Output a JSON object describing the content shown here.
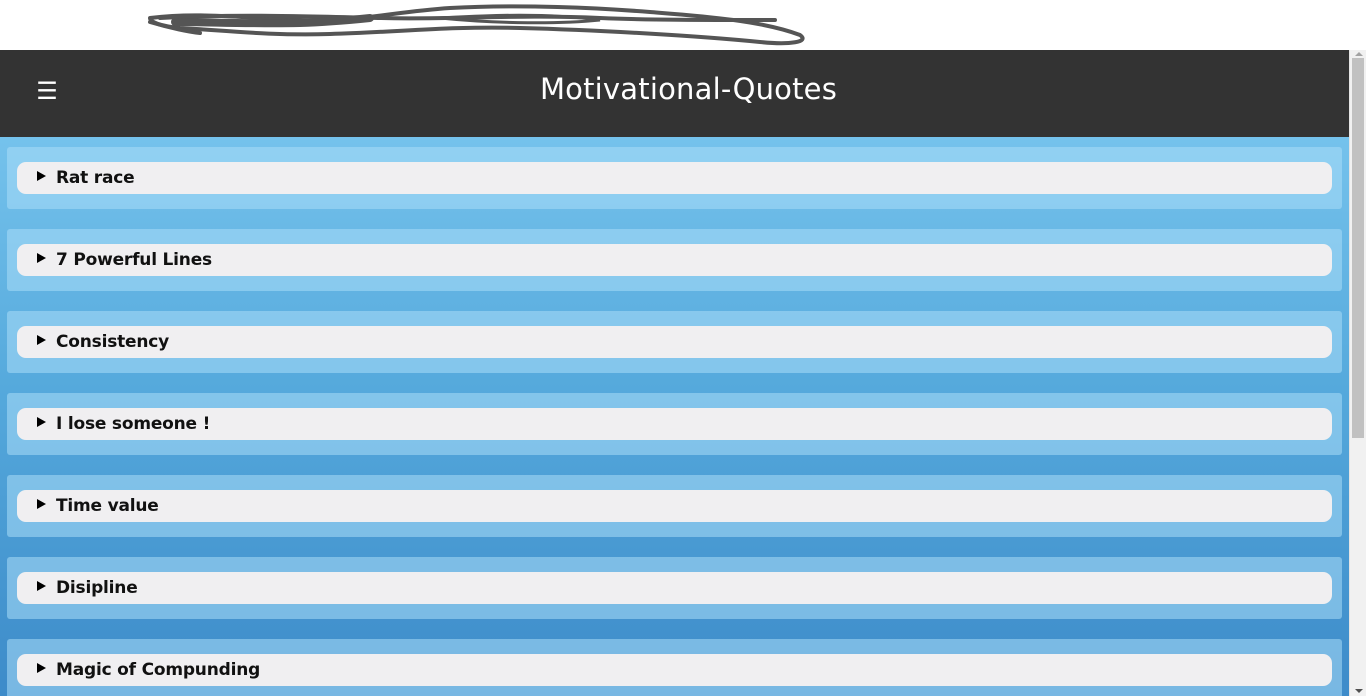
{
  "header": {
    "menu_icon": "hamburger-menu-icon",
    "menu_glyph": "☰",
    "title": "Motivational-Quotes"
  },
  "colors": {
    "navbar": "#333333",
    "background_top": "#75c2ec",
    "background_bottom": "#3d8bc9",
    "summary_background": "#f0eff1",
    "text": "#111111"
  },
  "sections": [
    {
      "label": "Rat race",
      "expanded": false
    },
    {
      "label": "7 Powerful Lines",
      "expanded": false
    },
    {
      "label": "Consistency",
      "expanded": false
    },
    {
      "label": "I lose someone !",
      "expanded": false
    },
    {
      "label": "Time value",
      "expanded": false
    },
    {
      "label": "Disipline",
      "expanded": false
    },
    {
      "label": "Magic of Compunding",
      "expanded": false
    }
  ]
}
